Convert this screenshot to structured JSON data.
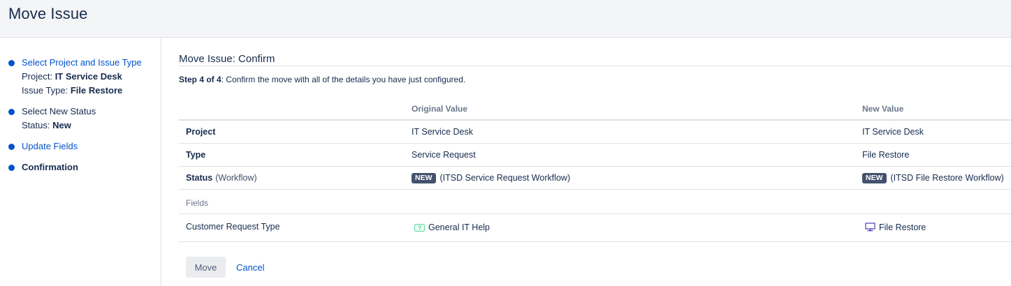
{
  "header": {
    "title": "Move Issue"
  },
  "sidebar": {
    "steps": [
      {
        "label": "Select Project and Issue Type",
        "details": [
          {
            "key": "Project: ",
            "value": "IT Service Desk"
          },
          {
            "key": "Issue Type: ",
            "value": "File Restore"
          }
        ]
      },
      {
        "label": "Select New Status",
        "details": [
          {
            "key": "Status: ",
            "value": "New"
          }
        ]
      },
      {
        "label": "Update Fields"
      },
      {
        "label": "Confirmation"
      }
    ]
  },
  "main": {
    "title": "Move Issue: Confirm",
    "step_prefix": "Step 4 of 4",
    "step_text": ": Confirm the move with all of the details you have just configured.",
    "columns": {
      "original": "Original Value",
      "new": "New Value"
    },
    "rows": {
      "project": {
        "label": "Project",
        "original": "IT Service Desk",
        "new": "IT Service Desk"
      },
      "type": {
        "label": "Type",
        "original": "Service Request",
        "new": "File Restore"
      },
      "status": {
        "label": "Status",
        "label_note": "(Workflow)",
        "original_lozenge": "NEW",
        "original_workflow": "(ITSD Service Request Workflow)",
        "new_lozenge": "NEW",
        "new_workflow": "(ITSD File Restore Workflow)"
      }
    },
    "fields_heading": "Fields",
    "fields": {
      "customer_request_type": {
        "label": "Customer Request Type",
        "original": "General IT Help",
        "original_icon": "help-ticket-icon",
        "new": "File Restore",
        "new_icon": "monitor-icon"
      }
    },
    "actions": {
      "move": "Move",
      "cancel": "Cancel"
    }
  }
}
